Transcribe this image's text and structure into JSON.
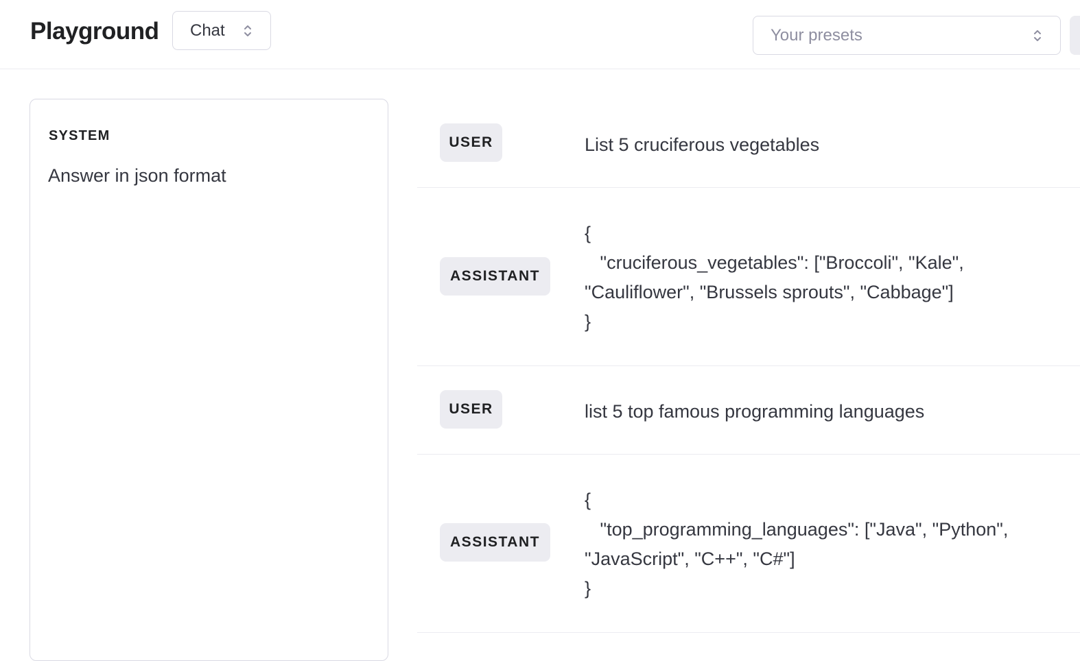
{
  "header": {
    "title": "Playground",
    "mode": "Chat",
    "presets_placeholder": "Your presets"
  },
  "system": {
    "label": "SYSTEM",
    "text": "Answer in json format"
  },
  "messages": [
    {
      "role": "USER",
      "content": "List 5 cruciferous vegetables"
    },
    {
      "role": "ASSISTANT",
      "content": "{\n   \"cruciferous_vegetables\": [\"Broccoli\", \"Kale\",\n\"Cauliflower\", \"Brussels sprouts\", \"Cabbage\"]\n}"
    },
    {
      "role": "USER",
      "content": "list 5 top famous programming languages"
    },
    {
      "role": "ASSISTANT",
      "content": "{\n   \"top_programming_languages\": [\"Java\", \"Python\",\n\"JavaScript\", \"C++\", \"C#\"]\n}"
    }
  ]
}
